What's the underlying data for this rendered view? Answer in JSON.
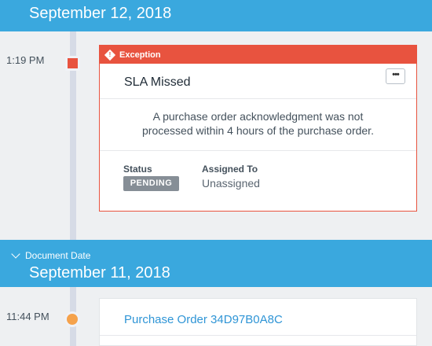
{
  "top_header": {
    "date": "September 12, 2018"
  },
  "exception_event": {
    "time": "1:19 PM",
    "badge_label": "Exception",
    "title": "SLA Missed",
    "more_label": "•••",
    "description_line1": "A purchase order acknowledgment was not",
    "description_line2": "processed within 4 hours of the purchase order.",
    "status_label": "Status",
    "status_value": "PENDING",
    "assigned_label": "Assigned To",
    "assigned_value": "Unassigned"
  },
  "section_header": {
    "sub_label": "Document Date",
    "date": "September 11, 2018"
  },
  "po_event": {
    "time": "11:44 PM",
    "title": "Purchase Order 34D97B0A8C"
  },
  "colors": {
    "header_blue": "#3aa8de",
    "exception_red": "#e8533f",
    "marker_orange": "#f5a24c",
    "link_blue": "#2f95d6",
    "pill_gray": "#868e96"
  }
}
